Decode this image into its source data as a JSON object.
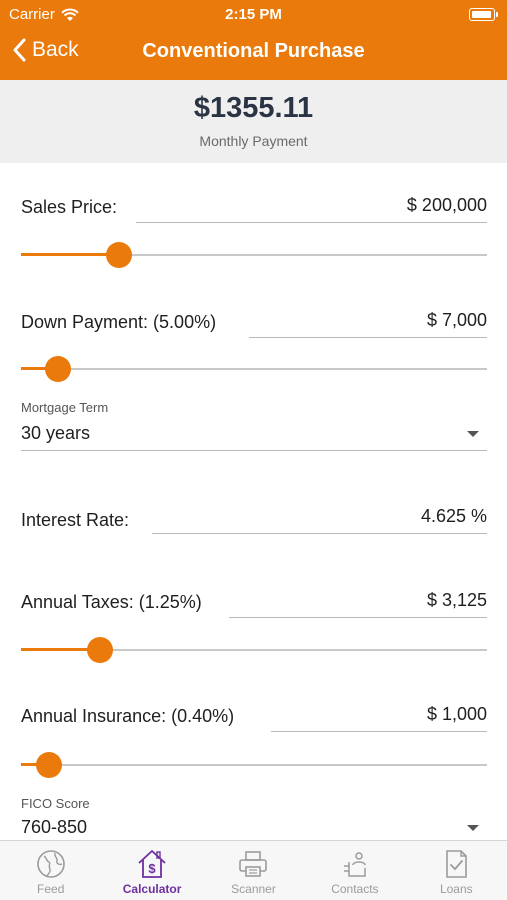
{
  "status_bar": {
    "carrier": "Carrier",
    "time": "2:15 PM"
  },
  "nav": {
    "back_label": "Back",
    "title": "Conventional Purchase"
  },
  "summary": {
    "amount": "$1355.11",
    "label": "Monthly Payment"
  },
  "form": {
    "sales_price": {
      "label": "Sales Price:",
      "value": "$ 200,000",
      "slider_fraction": 0.21
    },
    "down_payment": {
      "label": "Down Payment: (5.00%)",
      "value": "$ 7,000",
      "slider_fraction": 0.08
    },
    "mortgage_term": {
      "label": "Mortgage Term",
      "value": "30 years"
    },
    "interest_rate": {
      "label": "Interest Rate:",
      "value": "4.625 %"
    },
    "annual_taxes": {
      "label": "Annual Taxes: (1.25%)",
      "value": "$ 3,125",
      "slider_fraction": 0.17
    },
    "annual_insurance": {
      "label": "Annual Insurance: (0.40%)",
      "value": "$ 1,000",
      "slider_fraction": 0.06
    },
    "fico_score": {
      "label": "FICO Score",
      "value": "760-850"
    }
  },
  "tabs": [
    {
      "label": "Feed",
      "icon": "globe-icon",
      "active": false
    },
    {
      "label": "Calculator",
      "icon": "house-dollar-icon",
      "active": true
    },
    {
      "label": "Scanner",
      "icon": "printer-icon",
      "active": false
    },
    {
      "label": "Contacts",
      "icon": "contact-card-icon",
      "active": false
    },
    {
      "label": "Loans",
      "icon": "checklist-icon",
      "active": false
    }
  ],
  "colors": {
    "accent": "#e97a0b",
    "active_tab": "#6e2fa0",
    "inactive_tab": "#9b9b9b",
    "summary_bg": "#efefef"
  }
}
